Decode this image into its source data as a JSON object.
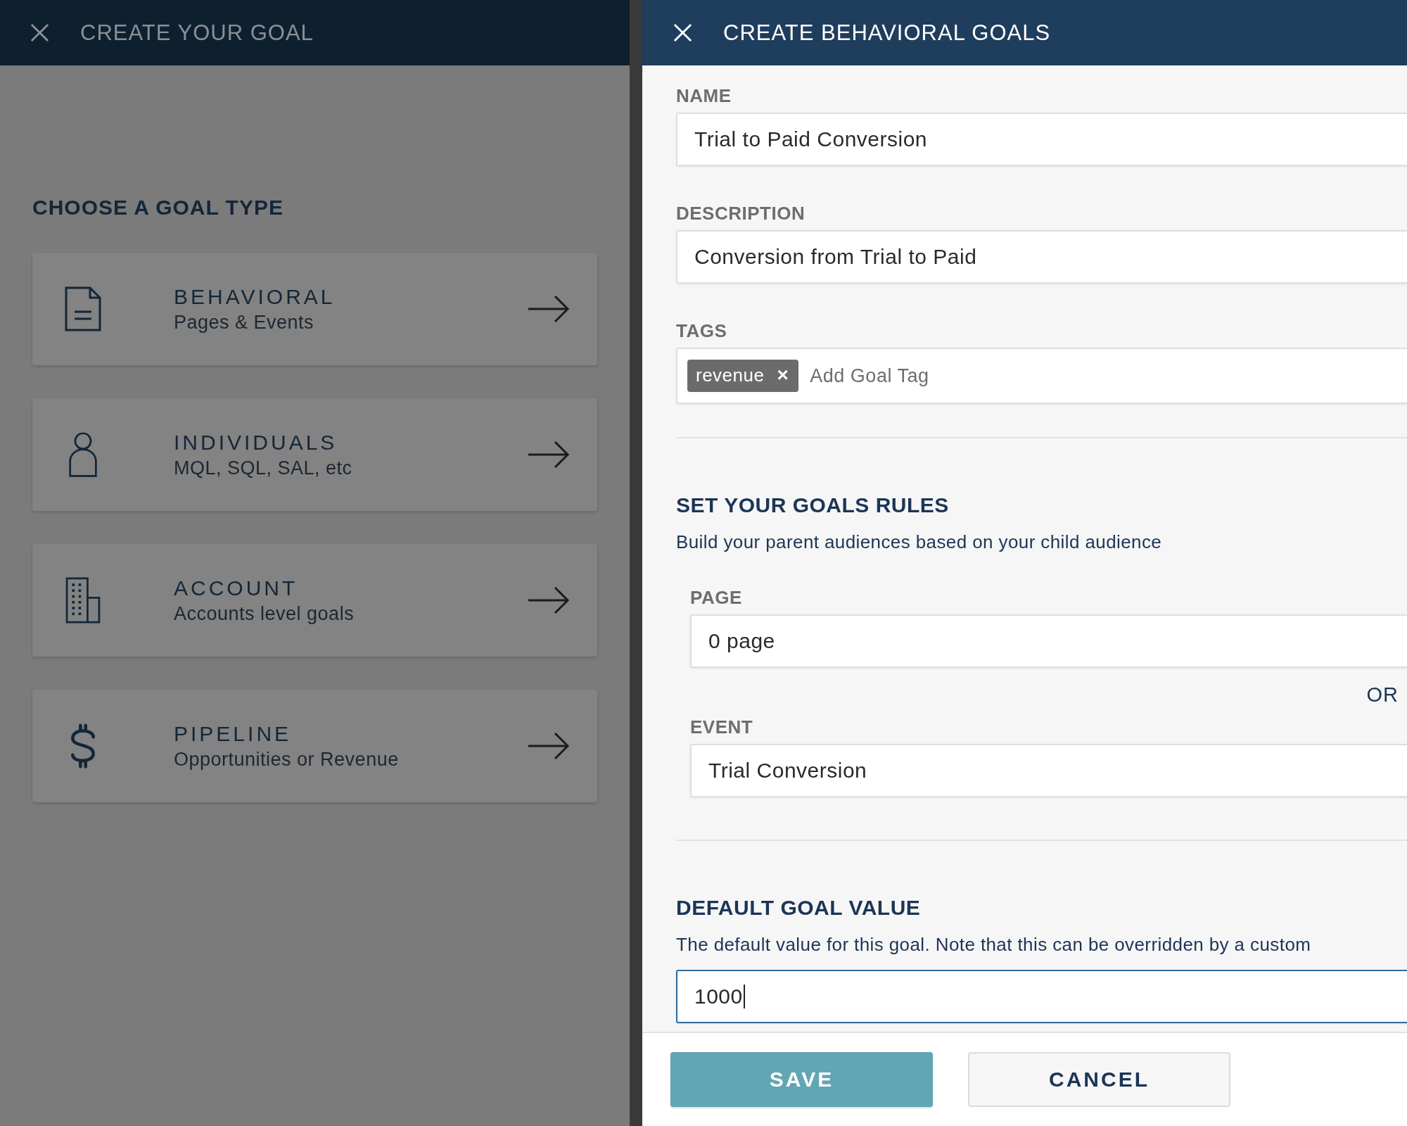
{
  "left_panel": {
    "title": "CREATE YOUR GOAL",
    "heading": "CHOOSE A GOAL TYPE",
    "goal_types": [
      {
        "kind": "document",
        "title": "BEHAVIORAL",
        "subtitle": "Pages & Events"
      },
      {
        "kind": "person",
        "title": "INDIVIDUALS",
        "subtitle": "MQL, SQL, SAL, etc"
      },
      {
        "kind": "building",
        "title": "ACCOUNT",
        "subtitle": "Accounts level goals"
      },
      {
        "kind": "dollar",
        "title": "PIPELINE",
        "subtitle": "Opportunities or Revenue"
      }
    ]
  },
  "dialog": {
    "title": "CREATE BEHAVIORAL GOALS",
    "name": {
      "label": "NAME",
      "value": "Trial to Paid Conversion"
    },
    "description": {
      "label": "DESCRIPTION",
      "value": "Conversion from Trial to Paid"
    },
    "tags": {
      "label": "TAGS",
      "chips": [
        {
          "label": "revenue",
          "remove": "×"
        }
      ],
      "placeholder": "Add Goal Tag"
    },
    "rules": {
      "heading": "SET YOUR GOALS RULES",
      "subtitle": "Build your parent audiences based on your child audience",
      "page": {
        "label": "PAGE",
        "value": "0 page"
      },
      "separator": "OR",
      "event": {
        "label": "EVENT",
        "value": "Trial Conversion"
      }
    },
    "default_value": {
      "heading": "DEFAULT GOAL VALUE",
      "subtitle": "The default value for this goal. Note that this can be overridden by a custom",
      "value": "1000",
      "focused": true
    },
    "buttons": [
      {
        "kind": "primary",
        "label": "SAVE"
      },
      {
        "kind": "secondary",
        "label": "CANCEL"
      }
    ]
  }
}
